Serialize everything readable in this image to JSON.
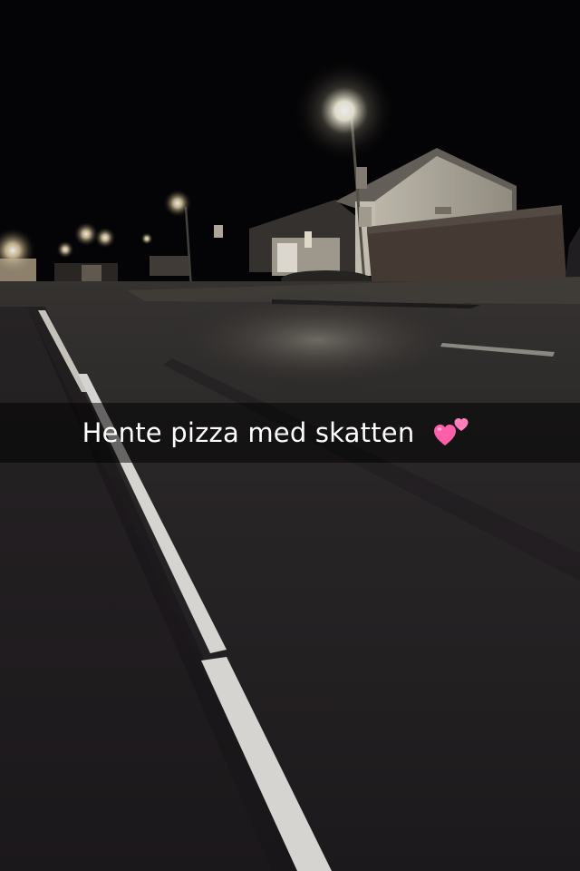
{
  "caption": {
    "text": "Hente pizza med skatten",
    "emoji": "two-hearts-icon"
  },
  "colors": {
    "sky": "#050406",
    "road": "#2a2729",
    "lane_marking": "#e8e6e2",
    "lamp_glow": "#fffbe8",
    "house_wall": "#d9d4c8",
    "heart_pink": "#ff5fa8"
  }
}
